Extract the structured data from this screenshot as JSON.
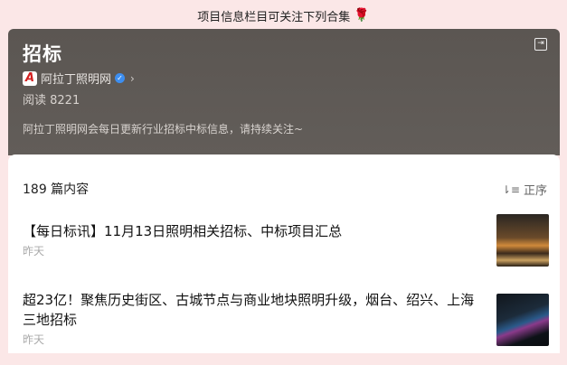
{
  "banner": {
    "text": "项目信息栏目可关注下列合集",
    "emoji": "🌹"
  },
  "header": {
    "title": "招标",
    "source_name": "阿拉丁照明网",
    "logo_letter": "A",
    "reads": "阅读 8221",
    "description": "阿拉丁照明网会每日更新行业招标中标信息，请持续关注~"
  },
  "list": {
    "count": "189 篇内容",
    "sort_label": "正序",
    "items": [
      {
        "title": "【每日标讯】11月13日照明相关招标、中标项目汇总",
        "date": "昨天"
      },
      {
        "title": "超23亿！聚焦历史街区、古城节点与商业地块照明升级，烟台、绍兴、上海三地招标",
        "date": "昨天"
      }
    ]
  },
  "colors": {
    "header_bg": "#5b5652",
    "page_bg": "#fbe7e7",
    "verified": "#3d8ef0",
    "logo": "#d32020"
  },
  "icons": [
    "exit-icon",
    "verified-icon",
    "chevron-right-icon",
    "sort-icon"
  ]
}
